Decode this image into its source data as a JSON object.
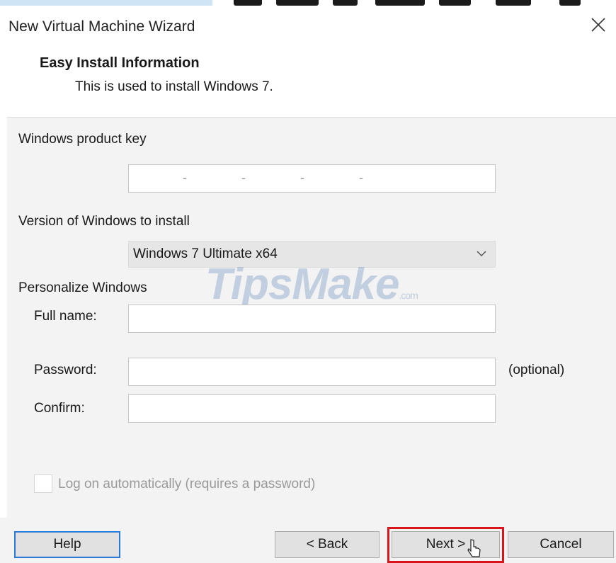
{
  "window": {
    "title": "New Virtual Machine Wizard",
    "close_icon": "close-icon"
  },
  "header": {
    "title": "Easy Install Information",
    "subtitle": "This is used to install Windows 7."
  },
  "product_key": {
    "label": "Windows product key",
    "value": "",
    "separators": [
      "-",
      "-",
      "-",
      "-"
    ]
  },
  "version": {
    "label": "Version of Windows to install",
    "selected": "Windows 7 Ultimate x64",
    "dropdown_icon": "chevron-down-icon"
  },
  "personalize": {
    "section_label": "Personalize Windows",
    "full_name_label": "Full name:",
    "full_name_value": "",
    "password_label": "Password:",
    "password_value": "",
    "password_hint": "(optional)",
    "confirm_label": "Confirm:",
    "confirm_value": ""
  },
  "auto_logon": {
    "label": "Log on automatically (requires a password)",
    "checked": false,
    "enabled": false
  },
  "watermark": {
    "text": "TipsMake",
    "suffix": ".com"
  },
  "buttons": {
    "help": "Help",
    "back": "< Back",
    "next": "Next >",
    "cancel": "Cancel"
  },
  "colors": {
    "highlight_border": "#d9141b",
    "primary_button_border": "#2b78d6",
    "panel_background": "#f3f3f3"
  }
}
